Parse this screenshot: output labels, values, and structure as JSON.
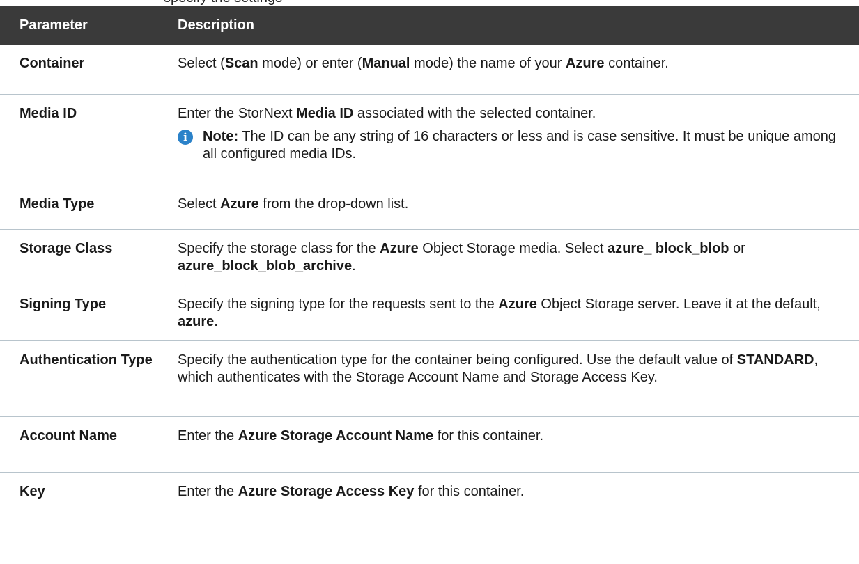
{
  "partial_heading": "specify the settings",
  "table": {
    "header": {
      "col1": "Parameter",
      "col2": "Description"
    },
    "rows": [
      {
        "name": "Container",
        "desc": {
          "p1": "Select (",
          "b1": "Scan",
          "p2": " mode) or enter (",
          "b2": "Manual",
          "p3": " mode) the name of your ",
          "b3": "Azure",
          "p4": " container."
        }
      },
      {
        "name": "Media ID",
        "desc": {
          "p1": "Enter the StorNext ",
          "b1": "Media ID",
          "p2": " associated with the selected container."
        },
        "note": {
          "label": "Note:",
          "text": " The ID can be any string of 16 characters or less and is case sensitive. It must be unique among all configured media IDs."
        }
      },
      {
        "name": "Media Type",
        "desc": {
          "p1": "Select ",
          "b1": "Azure",
          "p2": " from the drop-down list."
        }
      },
      {
        "name": "Storage Class",
        "desc": {
          "p1": "Specify the storage class for the ",
          "b1": "Azure",
          "p2": " Object Storage media. Select ",
          "b2": "azure_ block_blob",
          "p3": " or ",
          "b3": "azure_block_blob_archive",
          "p4": "."
        }
      },
      {
        "name": "Signing Type",
        "desc": {
          "p1": "Specify the signing type for the requests sent to the ",
          "b1": "Azure",
          "p2": " Object Storage server. Leave it at the default, ",
          "b2": "azure",
          "p3": "."
        }
      },
      {
        "name": "Authentication Type",
        "desc": {
          "p1": "Specify the authentication type for the container being configured. Use the default value of ",
          "b1": "STANDARD",
          "p2": ", which authenticates with the Storage Account Name and Storage Access Key."
        }
      },
      {
        "name": "Account Name",
        "desc": {
          "p1": "Enter the ",
          "b1": "Azure Storage Account Name",
          "p2": " for this container."
        }
      },
      {
        "name": "Key",
        "desc": {
          "p1": "Enter the ",
          "b1": "Azure Storage Access Key",
          "p2": " for this container."
        }
      }
    ]
  },
  "icons": {
    "note_icon": "info-icon",
    "note_icon_color": "#2b82c9"
  },
  "colors": {
    "header_bg": "#3a3a3a",
    "row_divider": "#b8c4cc"
  }
}
